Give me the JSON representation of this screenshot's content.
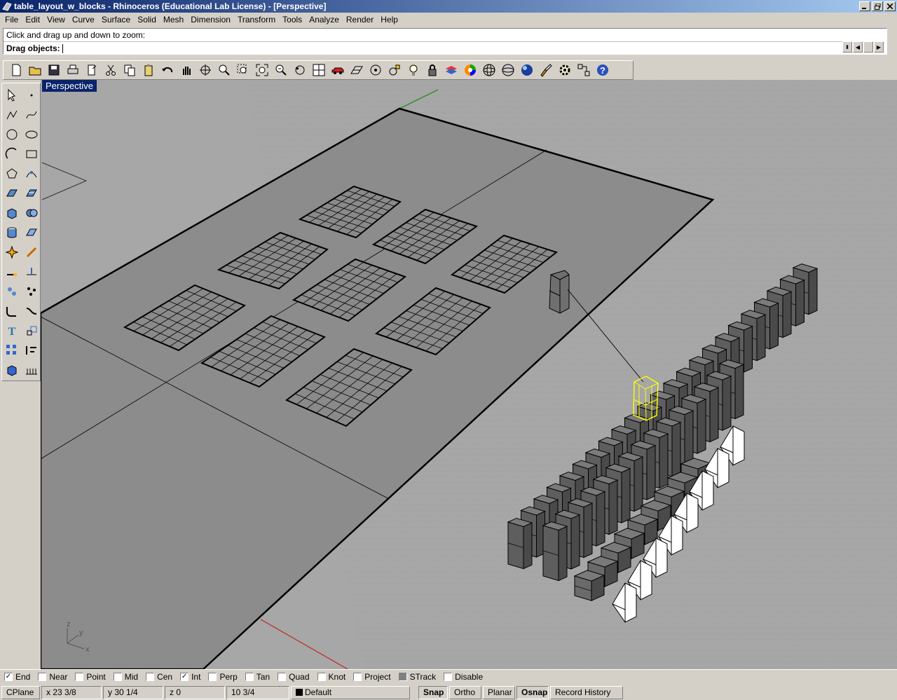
{
  "window": {
    "title": "table_layout_w_blocks - Rhinoceros (Educational Lab License) - [Perspective]"
  },
  "menu": [
    "File",
    "Edit",
    "View",
    "Curve",
    "Surface",
    "Solid",
    "Mesh",
    "Dimension",
    "Transform",
    "Tools",
    "Analyze",
    "Render",
    "Help"
  ],
  "command": {
    "history": "Click and drag up and down to zoom:",
    "prompt": "Drag objects:"
  },
  "viewport": {
    "label": "Perspective",
    "axes": {
      "z": "z",
      "y": "y",
      "x": "x"
    }
  },
  "toolbar_icons": [
    "new-icon",
    "open-icon",
    "save-icon",
    "print-icon",
    "import-icon",
    "cut-icon",
    "copy-icon",
    "paste-icon",
    "undo-icon",
    "pan-icon",
    "rotate-view-icon",
    "zoom-icon",
    "zoom-window-icon",
    "zoom-extents-icon",
    "zoom-selected-icon",
    "undo-view-icon",
    "four-viewports-icon",
    "car-icon",
    "grid-icon",
    "point-icon",
    "osnap-icon",
    "light-icon",
    "lock-icon",
    "layer-icon",
    "color-wheel-icon",
    "wireframe-sphere-icon",
    "shaded-sphere-icon",
    "render-sphere-icon",
    "brush-icon",
    "settings-icon",
    "toolbar-layout-icon",
    "help-icon"
  ],
  "osnaps": [
    {
      "label": "End",
      "checked": true
    },
    {
      "label": "Near",
      "checked": false
    },
    {
      "label": "Point",
      "checked": false
    },
    {
      "label": "Mid",
      "checked": false
    },
    {
      "label": "Cen",
      "checked": false
    },
    {
      "label": "Int",
      "checked": true
    },
    {
      "label": "Perp",
      "checked": false
    },
    {
      "label": "Tan",
      "checked": false
    },
    {
      "label": "Quad",
      "checked": false
    },
    {
      "label": "Knot",
      "checked": false
    },
    {
      "label": "Project",
      "checked": false
    },
    {
      "label": "STrack",
      "checked": false,
      "gray": true
    },
    {
      "label": "Disable",
      "checked": false
    }
  ],
  "status": {
    "cplane": "CPlane",
    "x": "x 23 3/8",
    "y": "y 30 1/4",
    "z": "z 0",
    "distance": "10 3/4",
    "layer": "Default",
    "snap": "Snap",
    "ortho": "Ortho",
    "planar": "Planar",
    "osnap": "Osnap",
    "record_history": "Record History"
  },
  "colors": {
    "titlebar": "#0a246a",
    "viewport": "#a7a7a7",
    "table": "#8c8c8c",
    "selected": "#ffff00"
  }
}
